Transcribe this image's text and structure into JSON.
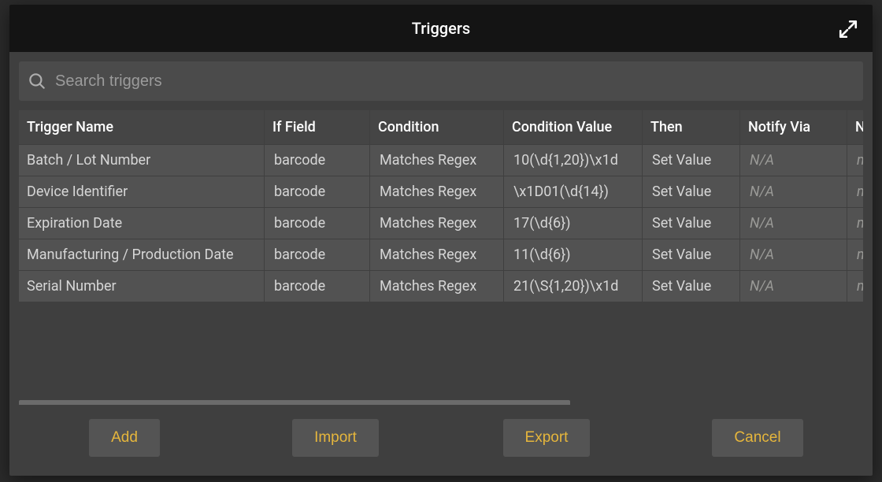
{
  "dialog": {
    "title": "Triggers"
  },
  "search": {
    "placeholder": "Search triggers",
    "value": ""
  },
  "table": {
    "headers": {
      "name": "Trigger Name",
      "if_field": "If Field",
      "condition": "Condition",
      "cond_value": "Condition Value",
      "then": "Then",
      "notify_via": "Notify Via",
      "next": "No"
    },
    "rows": [
      {
        "name": "Batch / Lot Number",
        "if_field": "barcode",
        "condition": "Matches Regex",
        "cond_value": "10(\\d{1,20})\\x1d",
        "then": "Set Value",
        "notify_via": "N/A",
        "next": "n/"
      },
      {
        "name": "Device Identifier",
        "if_field": "barcode",
        "condition": "Matches Regex",
        "cond_value": "\\x1D01(\\d{14})",
        "then": "Set Value",
        "notify_via": "N/A",
        "next": "n/"
      },
      {
        "name": "Expiration Date",
        "if_field": "barcode",
        "condition": "Matches Regex",
        "cond_value": "17(\\d{6})",
        "then": "Set Value",
        "notify_via": "N/A",
        "next": "n/"
      },
      {
        "name": "Manufacturing / Production Date",
        "if_field": "barcode",
        "condition": "Matches Regex",
        "cond_value": "11(\\d{6})",
        "then": "Set Value",
        "notify_via": "N/A",
        "next": "n/"
      },
      {
        "name": "Serial Number",
        "if_field": "barcode",
        "condition": "Matches Regex",
        "cond_value": "21(\\S{1,20})\\x1d",
        "then": "Set Value",
        "notify_via": "N/A",
        "next": "n/"
      }
    ]
  },
  "buttons": {
    "add": "Add",
    "import": "Import",
    "export": "Export",
    "cancel": "Cancel"
  }
}
